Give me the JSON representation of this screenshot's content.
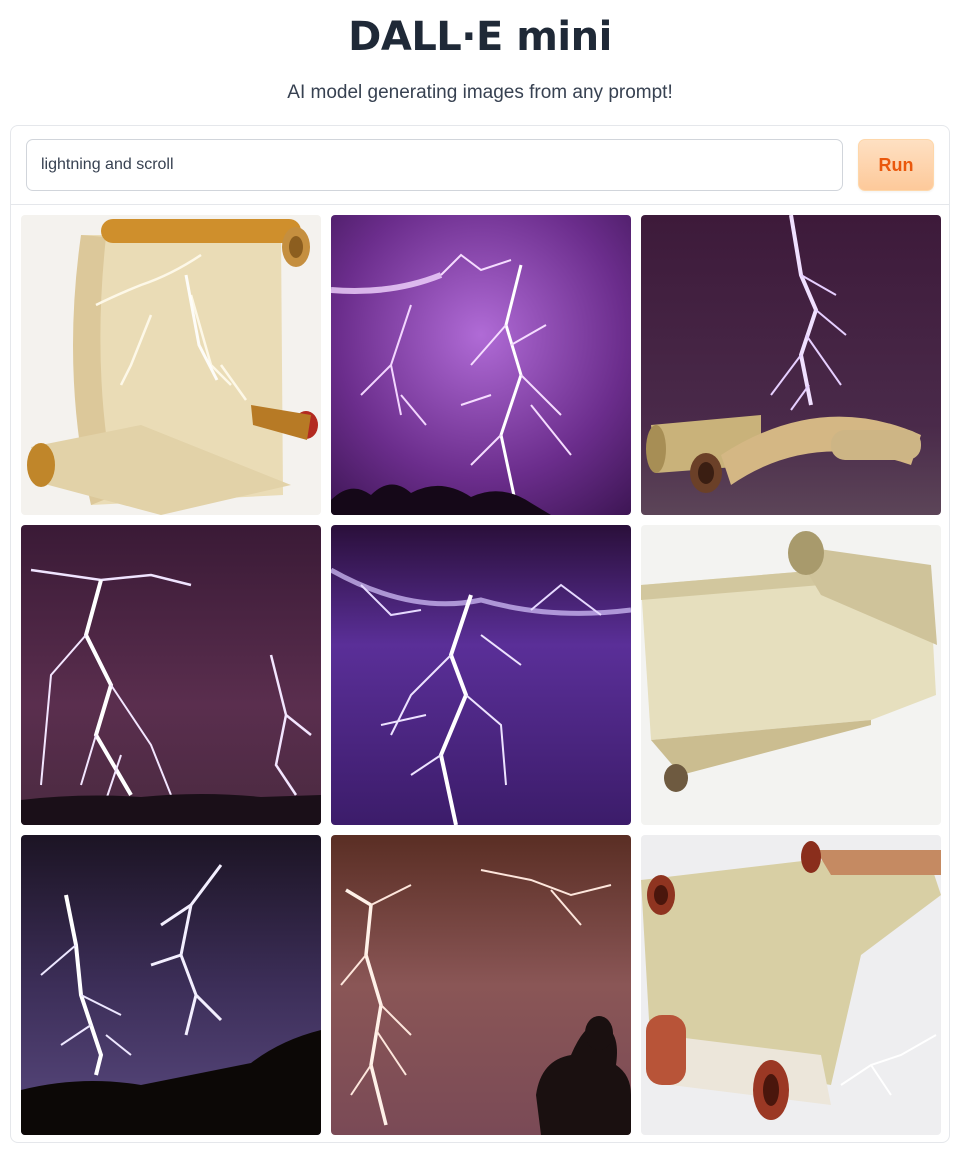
{
  "header": {
    "title": "DALL·E mini",
    "subtitle": "AI model generating images from any prompt!"
  },
  "prompt": {
    "value": "lightning and scroll",
    "run_label": "Run"
  },
  "gallery": {
    "images": [
      {
        "subject": "scroll with lightning cracks on white background"
      },
      {
        "subject": "purple lightning over dark treeline"
      },
      {
        "subject": "lightning bolt above rolled scrolls on dark purple"
      },
      {
        "subject": "lightning storm over dark horizon"
      },
      {
        "subject": "violet lightning bolt in purple sky"
      },
      {
        "subject": "unrolled parchment scroll on white background"
      },
      {
        "subject": "lightning strikes over dark hills at night"
      },
      {
        "subject": "lightning in brown sky with silhouette of person"
      },
      {
        "subject": "parchment scroll with red rollers on white background"
      }
    ]
  },
  "colors": {
    "accent": "#ea580c",
    "run_bg": "#fdd3ad",
    "border": "#e5e7eb"
  }
}
